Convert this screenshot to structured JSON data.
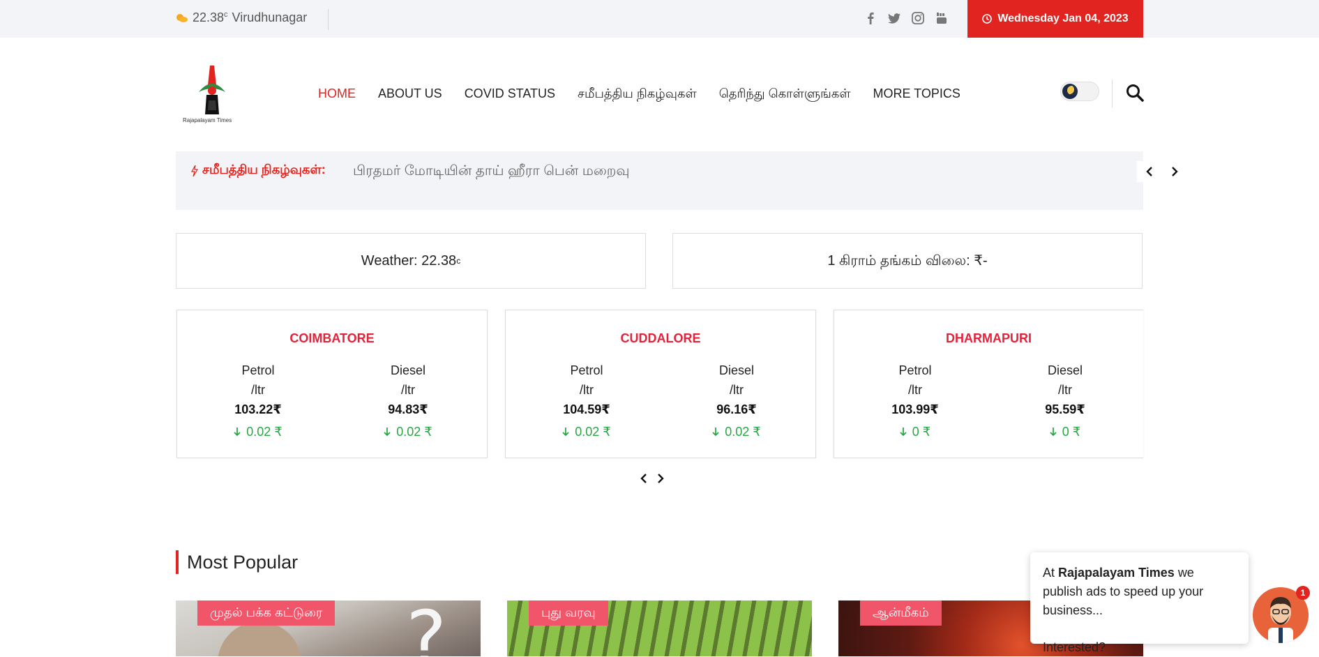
{
  "topbar": {
    "weather_temp": "22.38",
    "weather_unit": "c",
    "weather_city": "Virudhunagar",
    "date": "Wednesday Jan 04, 2023",
    "socials": [
      "facebook-icon",
      "twitter-icon",
      "instagram-icon",
      "youtube-icon"
    ],
    "accent_color": "#e1241f"
  },
  "header": {
    "logo_text": "Rajapalayam Times",
    "nav": [
      {
        "label": "HOME",
        "active": true
      },
      {
        "label": "ABOUT US",
        "active": false
      },
      {
        "label": "COVID STATUS",
        "active": false
      },
      {
        "label": "சமீபத்திய நிகழ்வுகள்",
        "active": false
      },
      {
        "label": "தெரிந்து கொள்ளுங்கள்",
        "active": false
      },
      {
        "label": "MORE TOPICS",
        "active": false
      }
    ]
  },
  "ticker": {
    "label": "சமீபத்திய நிகழ்வுகள்:",
    "text": "பிரதமர் மோடியின் தாய் ஹீரா பென் மறைவு"
  },
  "info": {
    "weather_label": "Weather: 22.38",
    "weather_unit": "c",
    "gold_label": "1 கிராம் தங்கம் விலை: ₹-"
  },
  "fuel": [
    {
      "city": "COIMBATORE",
      "petrol_label": "Petrol",
      "diesel_label": "Diesel",
      "unit": "/ltr",
      "petrol_price": "103.22₹",
      "diesel_price": "94.83₹",
      "petrol_change": "0.02 ₹",
      "diesel_change": "0.02 ₹"
    },
    {
      "city": "CUDDALORE",
      "petrol_label": "Petrol",
      "diesel_label": "Diesel",
      "unit": "/ltr",
      "petrol_price": "104.59₹",
      "diesel_price": "96.16₹",
      "petrol_change": "0.02 ₹",
      "diesel_change": "0.02 ₹"
    },
    {
      "city": "DHARMAPURI",
      "petrol_label": "Petrol",
      "diesel_label": "Diesel",
      "unit": "/ltr",
      "petrol_price": "103.99₹",
      "diesel_price": "95.59₹",
      "petrol_change": "0 ₹",
      "diesel_change": "0 ₹"
    }
  ],
  "popular": {
    "title": "Most Popular",
    "cards": [
      {
        "tag": "முதல் பக்க கட்டுரை"
      },
      {
        "tag": "புது வரவு"
      },
      {
        "tag": "ஆன்மீகம்"
      }
    ]
  },
  "chat": {
    "prefix": "At",
    "brand": "Rajapalayam Times",
    "suffix": "we publish ads to speed up your business...",
    "question": "Interested?",
    "badge": "1"
  }
}
